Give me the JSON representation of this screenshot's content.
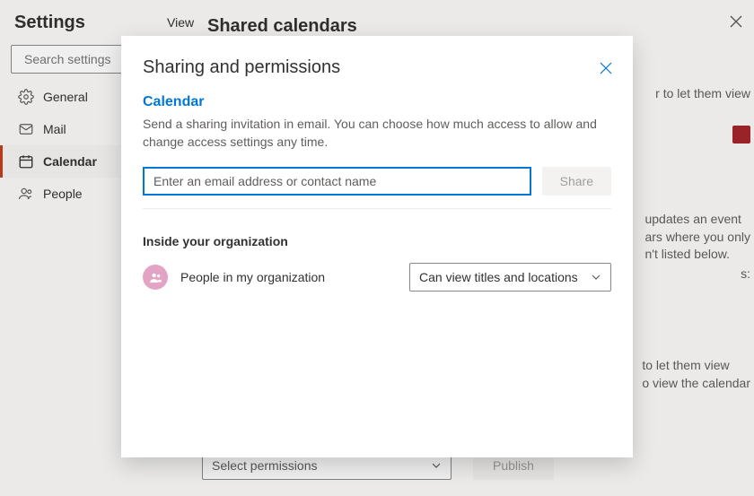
{
  "header": {
    "settings": "Settings",
    "view": "View"
  },
  "search": {
    "placeholder": "Search settings"
  },
  "nav": {
    "general": "General",
    "mail": "Mail",
    "calendar": "Calendar",
    "people": "People"
  },
  "panel": {
    "title": "Shared calendars",
    "bg_line1": "r to let them view",
    "bg_line2a": "updates an event",
    "bg_line2b": "ars where you only",
    "bg_line2c": "n't listed below.",
    "bg_line2d": "s:",
    "bg_line3a": "to let them view",
    "bg_line3b": "o view the calendar",
    "select_perm": "Select permissions",
    "publish": "Publish"
  },
  "modal": {
    "title": "Sharing and permissions",
    "section": "Calendar",
    "description": "Send a sharing invitation in email. You can choose how much access to allow and change access settings any time.",
    "email_placeholder": "Enter an email address or contact name",
    "share": "Share",
    "org_title": "Inside your organization",
    "org_label": "People in my organization",
    "perm_value": "Can view titles and locations"
  }
}
